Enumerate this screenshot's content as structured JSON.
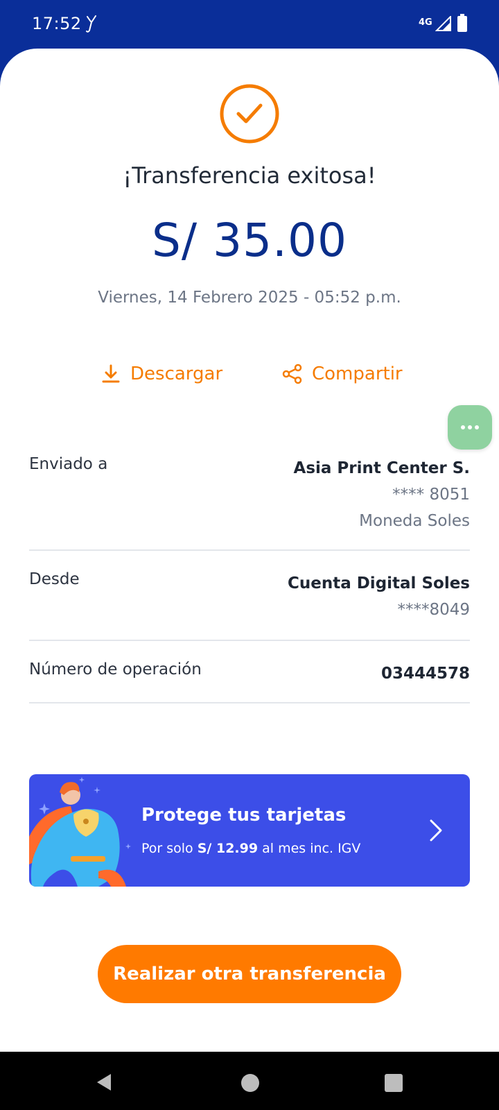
{
  "status_bar": {
    "time": "17:52",
    "network": "4G",
    "app_icon": "yape-icon"
  },
  "receipt": {
    "title": "¡Transferencia exitosa!",
    "amount": "S/ 35.00",
    "datetime": "Viernes, 14 Febrero 2025 - 05:52 p.m.",
    "actions": {
      "download_label": "Descargar",
      "share_label": "Compartir"
    }
  },
  "details": {
    "sent_to": {
      "label": "Enviado a",
      "name": "Asia Print Center S.",
      "account": "**** 8051",
      "currency": "Moneda Soles"
    },
    "from": {
      "label": "Desde",
      "account_name": "Cuenta Digital Soles",
      "account": "****8049"
    },
    "operation": {
      "label": "Número de operación",
      "number": "03444578"
    }
  },
  "promo": {
    "title": "Protege tus tarjetas",
    "sub_prefix": "Por solo",
    "price": "S/ 12.99",
    "sub_suffix": "al mes inc. IGV"
  },
  "cta": {
    "label": "Realizar otra transferencia"
  },
  "colors": {
    "brand_blue": "#0a2e99",
    "accent_orange": "#ff7a00",
    "promo_blue": "#3c4ee8",
    "chat_green": "#8fd2a0"
  }
}
